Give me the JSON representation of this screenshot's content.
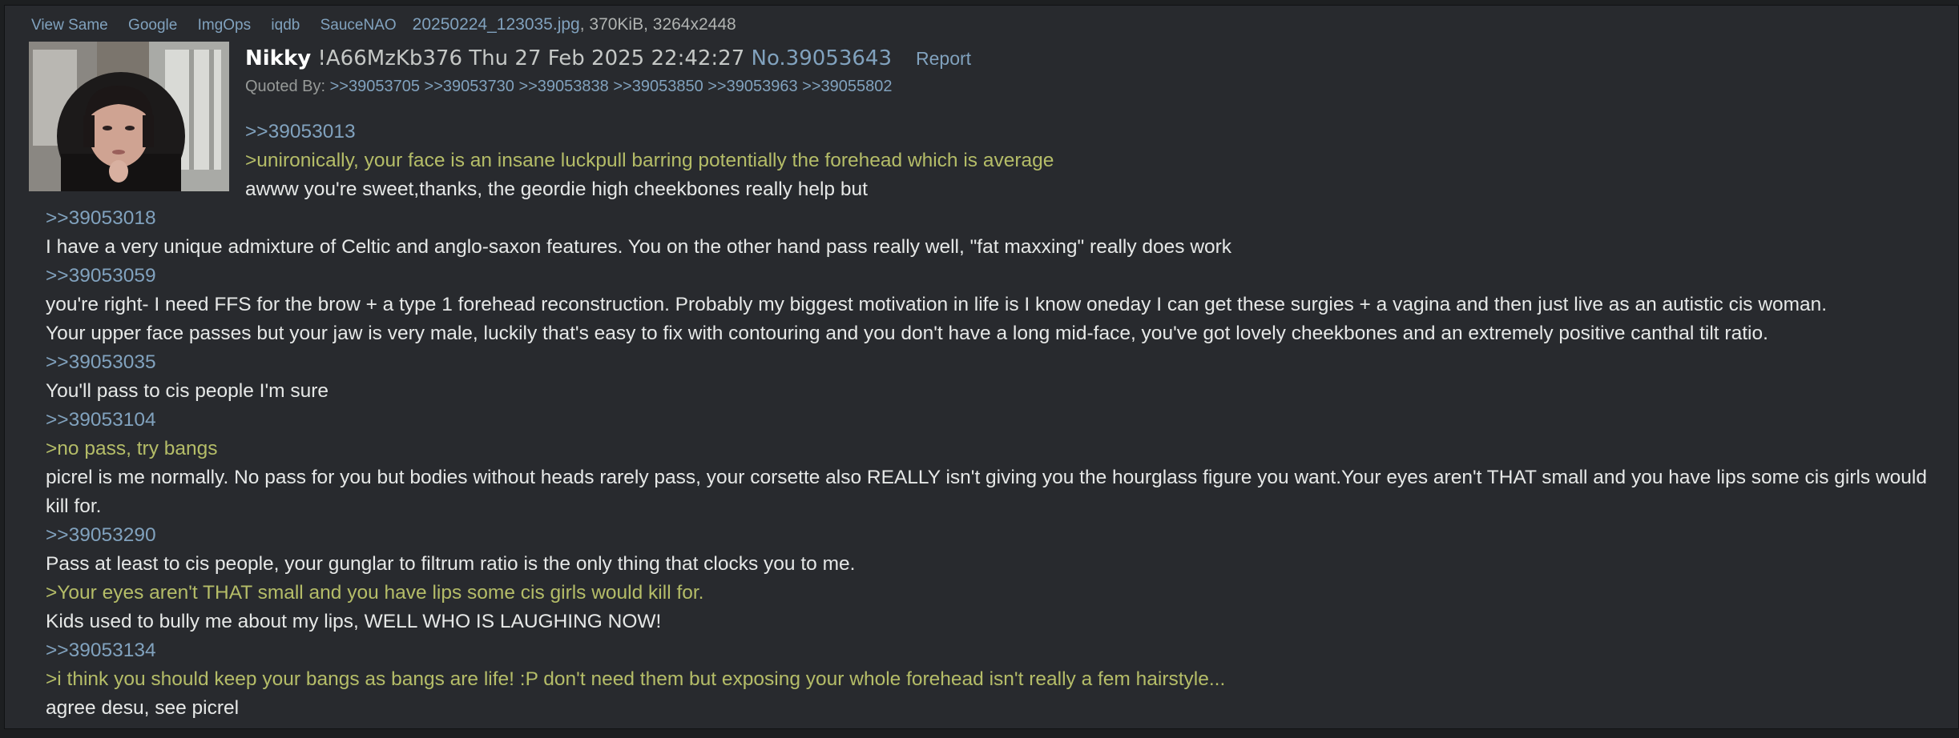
{
  "file": {
    "tools": [
      "View Same",
      "Google",
      "ImgOps",
      "iqdb",
      "SauceNAO"
    ],
    "filename": "20250224_123035.jpg",
    "meta": ", 370KiB, 3264x2448"
  },
  "post": {
    "name": "Nikky",
    "tripcode": " !A66MzKb376 ",
    "date": "Thu 27 Feb 2025 22:42:27 ",
    "number": "No.39053643",
    "report": "Report",
    "quoted_by_label": "Quoted By: ",
    "quoted_by": [
      ">>39053705",
      ">>39053730",
      ">>39053838",
      ">>39053850",
      ">>39053963",
      ">>39055802"
    ]
  },
  "body": {
    "l0": ">>39053013",
    "l1": ">unironically, your face is an insane luckpull barring potentially the forehead which is average",
    "l2": "awww you're sweet,thanks, the geordie high cheekbones really help but",
    "l3": ">>39053018",
    "l4": "I have a very unique admixture of Celtic and anglo-saxon features. You on the other hand pass really well, \"fat maxxing\" really does work",
    "l5": ">>39053059",
    "l6": "you're right- I need FFS for the brow + a type 1 forehead reconstruction. Probably my biggest motivation in life is I know oneday I can get these surgies + a vagina and then just live as an autistic cis woman.",
    "l7": "Your upper face passes but your jaw is very male, luckily that's easy to fix with contouring and you don't have a long mid-face, you've got lovely cheekbones and an extremely positive canthal tilt ratio.",
    "l8": ">>39053035",
    "l9": "You'll pass to cis people I'm sure",
    "l10": ">>39053104",
    "l11": ">no pass, try bangs",
    "l12": "picrel is me normally. No pass for you but bodies without heads rarely pass, your corsette also REALLY isn't giving you the hourglass figure you want.Your eyes aren't THAT small and you have lips some cis girls would kill for.",
    "l13": ">>39053290",
    "l14": "Pass at least to cis people, your gunglar to filtrum ratio is the only thing that clocks you to me.",
    "l15": ">Your eyes aren't THAT small and you have lips some cis girls would kill for.",
    "l16": "Kids used to bully me about my lips, WELL WHO IS LAUGHING NOW!",
    "l17": ">>39053134",
    "l18": ">i think you should keep your bangs as bangs are life! :P don't need them but exposing your whole forehead isn't really a fem hairstyle...",
    "l19": "agree desu, see picrel"
  },
  "colors": {
    "background": "#1d1f21",
    "post_background": "#282a2e",
    "link": "#81a2be",
    "greentext": "#b5bd68",
    "text": "#e6e8e7"
  }
}
